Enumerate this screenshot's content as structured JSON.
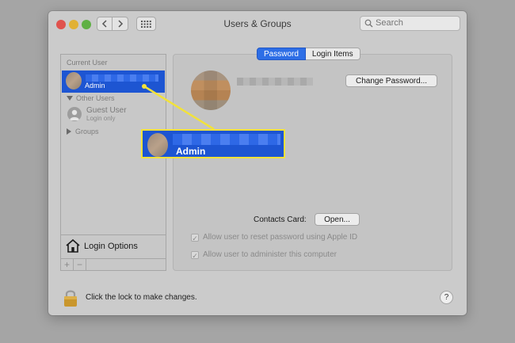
{
  "window": {
    "title": "Users & Groups"
  },
  "search": {
    "placeholder": "Search"
  },
  "sidebar": {
    "current_user_label": "Current User",
    "current_user_role": "Admin",
    "other_users_label": "Other Users",
    "guest_user_name": "Guest User",
    "guest_user_sub": "Login only",
    "groups_label": "Groups",
    "login_options_label": "Login Options",
    "add_label": "+",
    "remove_label": "−"
  },
  "tabs": [
    "Password",
    "Login Items"
  ],
  "password_pane": {
    "change_password_label": "Change Password...",
    "contacts_card_label": "Contacts Card:",
    "open_label": "Open...",
    "checkbox_reset": "Allow user to reset password using Apple ID",
    "checkbox_admin": "Allow user to administer this computer"
  },
  "footer": {
    "lock_text": "Click the lock to make changes.",
    "help_label": "?"
  },
  "callout": {
    "label": "Admin"
  },
  "colors": {
    "selection": "#1d55d2",
    "highlight_outline": "#f2e23a"
  }
}
